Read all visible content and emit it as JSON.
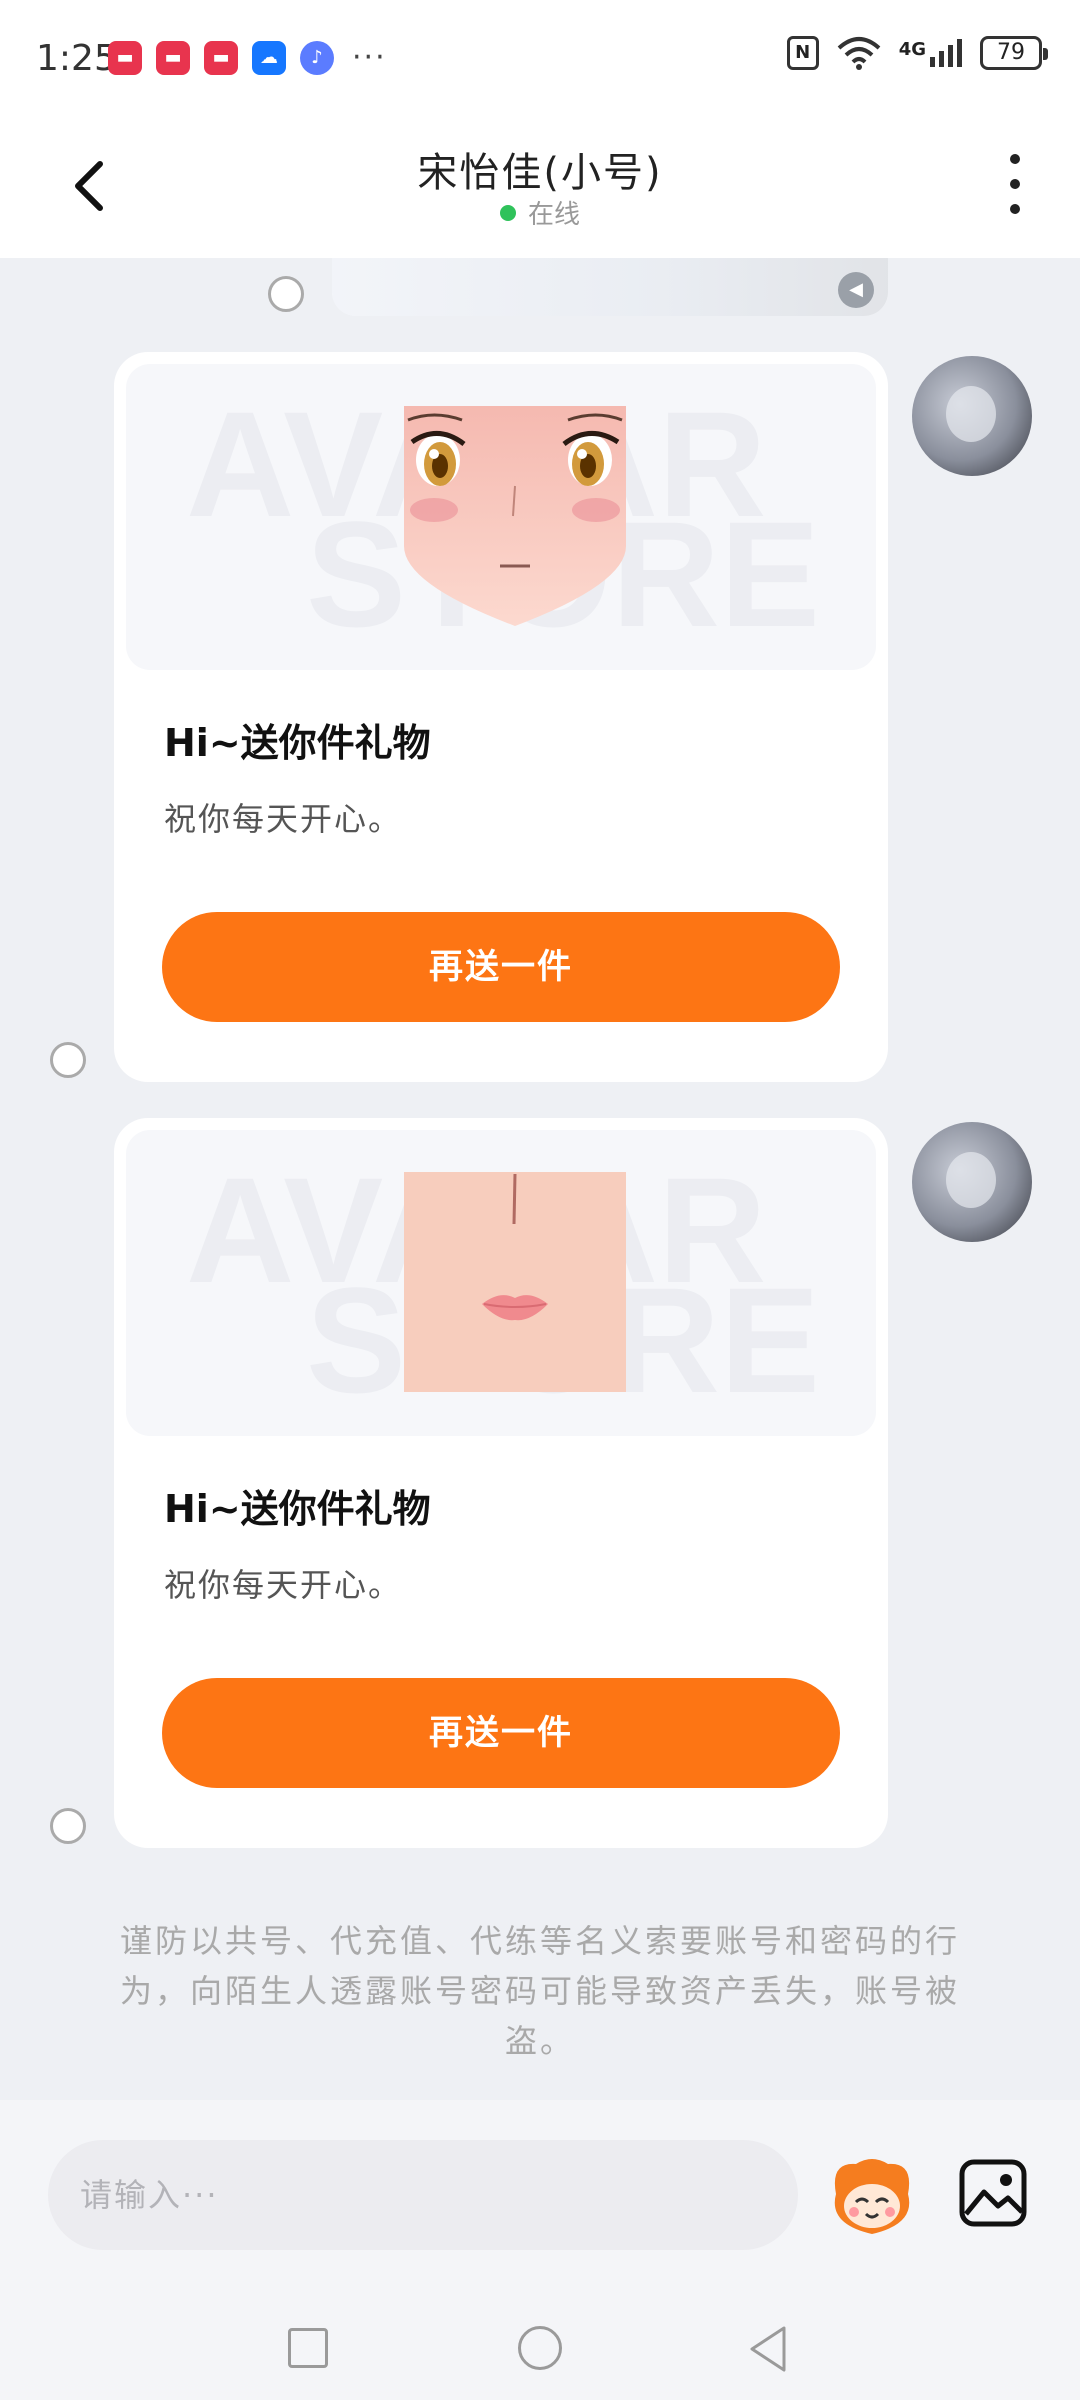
{
  "status_bar": {
    "time": "1:25",
    "more": "···",
    "signal": "4G",
    "battery": "79",
    "apps": [
      {
        "icon": "huawei-app-icon",
        "color": "#e8344e"
      },
      {
        "icon": "huawei-app-icon",
        "color": "#e8344e"
      },
      {
        "icon": "huawei-app-icon",
        "color": "#e8344e"
      },
      {
        "icon": "weather-app-icon",
        "color": "#1677ff"
      },
      {
        "icon": "music-app-icon",
        "color": "#5b7cff"
      }
    ]
  },
  "header": {
    "title": "宋怡佳(小号)",
    "status": "在线",
    "status_color": "#2fc25b"
  },
  "messages": [
    {
      "title": "Hi~送你件礼物",
      "desc": "祝你每天开心。",
      "button": "再送一件",
      "item": "eyes-face-item"
    },
    {
      "title": "Hi~送你件礼物",
      "desc": "祝你每天开心。",
      "button": "再送一件",
      "item": "mouth-item"
    }
  ],
  "watermark": "AVATAR STORE",
  "notice": "谨防以共号、代充值、代练等名义索要账号和密码的行为，向陌生人透露账号密码可能导致资产丢失，账号被盗。",
  "input": {
    "placeholder": "请输入···"
  },
  "colors": {
    "accent": "#fd7514",
    "background": "#eef0f4"
  }
}
